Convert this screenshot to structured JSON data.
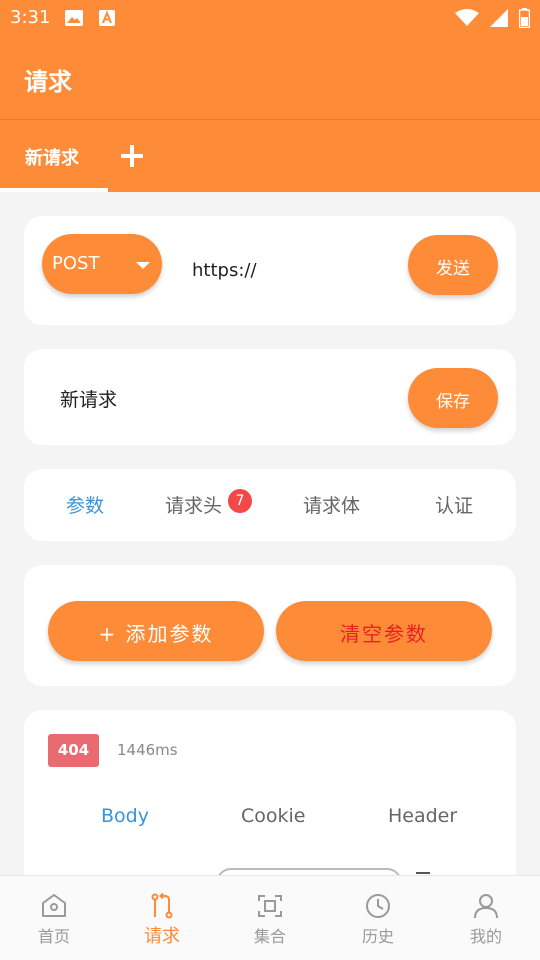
{
  "status_bar": {
    "time": "3:31"
  },
  "app_bar": {
    "title": "请求"
  },
  "tabs": {
    "current": "新请求",
    "add_icon": "plus-icon"
  },
  "request": {
    "method": "POST",
    "url": "https://",
    "send_label": "发送",
    "name": "新请求",
    "save_label": "保存"
  },
  "sub_tabs": [
    {
      "label": "参数",
      "active": true
    },
    {
      "label": "请求头",
      "badge": "7"
    },
    {
      "label": "请求体"
    },
    {
      "label": "认证"
    }
  ],
  "params": {
    "add_label": "+ 添加参数",
    "clear_label": "清空参数"
  },
  "response": {
    "status_code": "404",
    "time": "1446ms",
    "tabs": [
      "Body",
      "Cookie",
      "Header"
    ],
    "active_tab": "Body"
  },
  "bottom_nav": [
    {
      "label": "首页",
      "icon": "home-icon"
    },
    {
      "label": "请求",
      "icon": "request-icon",
      "active": true
    },
    {
      "label": "集合",
      "icon": "collection-icon"
    },
    {
      "label": "历史",
      "icon": "history-icon"
    },
    {
      "label": "我的",
      "icon": "profile-icon"
    }
  ],
  "colors": {
    "accent": "#fe8b37",
    "active_tab": "#3a94d8",
    "badge": "#f24848",
    "status_code": "#ea6b6f",
    "danger_text": "#e82222"
  }
}
